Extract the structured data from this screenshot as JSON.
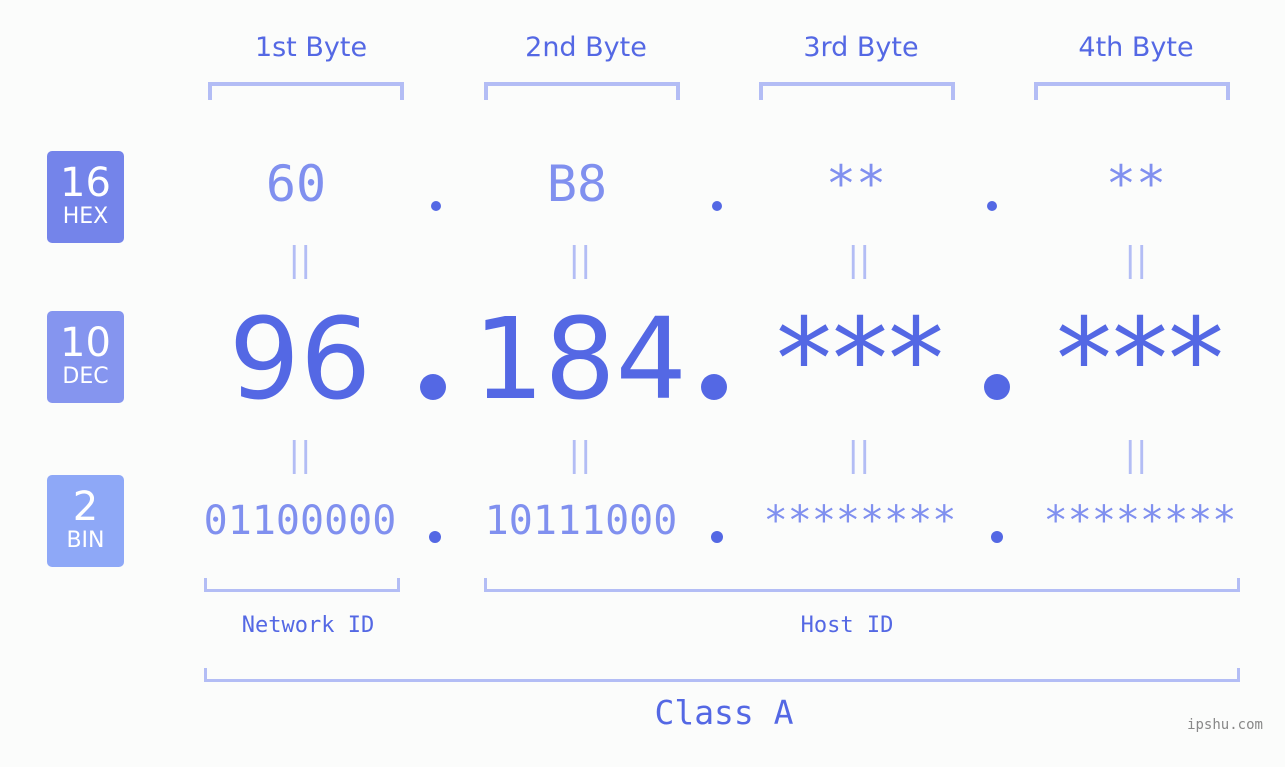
{
  "byte_headers": [
    "1st Byte",
    "2nd Byte",
    "3rd Byte",
    "4th Byte"
  ],
  "rows": {
    "hex": {
      "base": "16",
      "label": "HEX",
      "values": [
        "60",
        "B8",
        "**",
        "**"
      ]
    },
    "dec": {
      "base": "10",
      "label": "DEC",
      "values": [
        "96",
        "184",
        "***",
        "***"
      ]
    },
    "bin": {
      "base": "2",
      "label": "BIN",
      "values": [
        "01100000",
        "10111000",
        "********",
        "********"
      ]
    }
  },
  "equals_symbol": "||",
  "network_label": "Network ID",
  "host_label": "Host ID",
  "class_label": "Class A",
  "watermark": "ipshu.com",
  "colors": {
    "hex_badge": "#7484ea",
    "dec_badge": "#8595ef",
    "bin_badge": "#8ea8f7",
    "accent": "#5468e4",
    "bracket": "#b3bdf5"
  }
}
